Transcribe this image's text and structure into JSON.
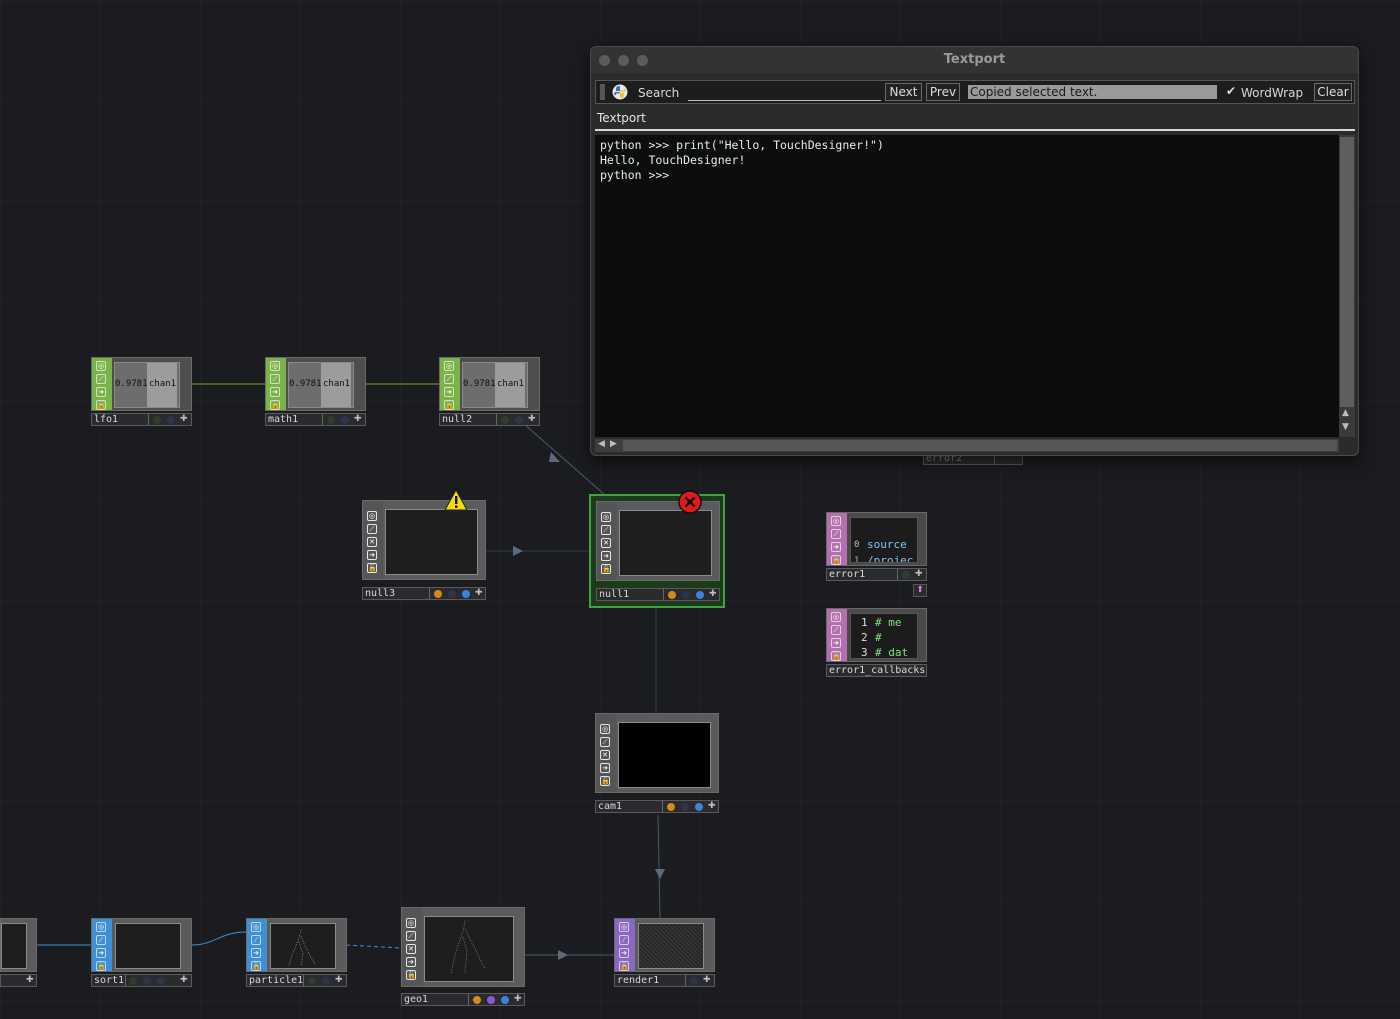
{
  "textport": {
    "title": "Textport",
    "search_label": "Search",
    "search_value": "",
    "next_label": "Next",
    "prev_label": "Prev",
    "status_message": "Copied selected text.",
    "wordwrap_label": "WordWrap",
    "wordwrap_checked": true,
    "clear_label": "Clear",
    "tab_label": "Textport",
    "lines": [
      "python >>> print(\"Hello, TouchDesigner!\")",
      "Hello, TouchDesigner!",
      "python >>>"
    ]
  },
  "nodes": {
    "lfo1": {
      "name": "lfo1",
      "value": "0.9781",
      "channel": "chan1"
    },
    "math1": {
      "name": "math1",
      "value": "0.9781",
      "channel": "chan1"
    },
    "null2": {
      "name": "null2",
      "value": "0.9781",
      "channel": "chan1"
    },
    "null3": {
      "name": "null3"
    },
    "null1": {
      "name": "null1"
    },
    "error2": {
      "name": "error2"
    },
    "error1": {
      "name": "error1",
      "rows": [
        "0",
        "source",
        "1",
        "/projec"
      ]
    },
    "error1_callbacks": {
      "name": "error1_callbacks",
      "lines": [
        "1",
        "# me",
        "2",
        "#",
        "3",
        "# dat"
      ]
    },
    "cam1": {
      "name": "cam1"
    },
    "sort1": {
      "name": "sort1"
    },
    "particle1": {
      "name": "particle1"
    },
    "geo1": {
      "name": "geo1"
    },
    "render1": {
      "name": "render1"
    }
  },
  "colors": {
    "chop": "#7bb24a",
    "sop": "#3f8fd6",
    "dat": "#b46fae",
    "top": "#8a68c2",
    "selected": "#3fa33f",
    "warning": "#f5d90a",
    "error": "#e01b1b"
  },
  "icons": {
    "warning": "warning-icon",
    "error": "error-icon",
    "python": "python-icon",
    "checkbox": "checkmark-icon"
  }
}
